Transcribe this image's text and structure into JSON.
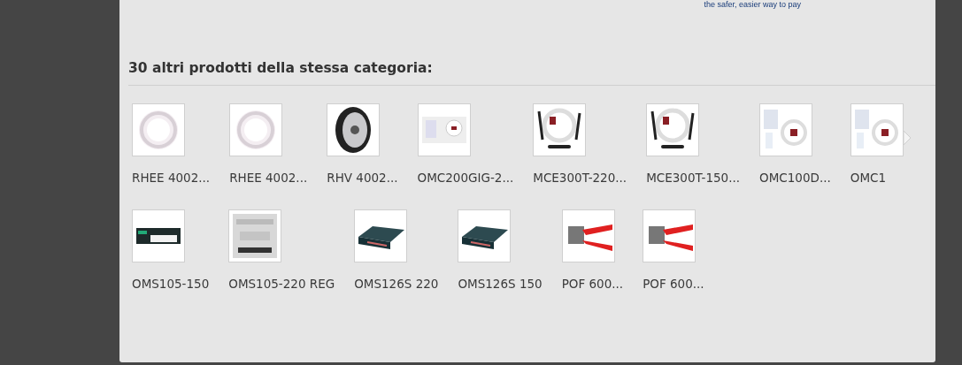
{
  "paypal_note": "the safer, easier way to pay",
  "section": {
    "title": "30 altri prodotti della stessa categoria:",
    "rows": [
      {
        "items": [
          {
            "label": "RHEE 4002..."
          },
          {
            "label": "RHEE 4002..."
          },
          {
            "label": "RHV 4002..."
          },
          {
            "label": "OMC200GIG-2..."
          },
          {
            "label": "MCE300T-220..."
          },
          {
            "label": "MCE300T-150..."
          },
          {
            "label": "OMC100D..."
          },
          {
            "label": "OMC1"
          }
        ],
        "has_next": true
      },
      {
        "items": [
          {
            "label": "OMS105-150"
          },
          {
            "label": "OMS105-220 REG"
          },
          {
            "label": "OMS126S 220"
          },
          {
            "label": "OMS126S 150"
          },
          {
            "label": "POF 600..."
          },
          {
            "label": "POF 600..."
          }
        ]
      }
    ]
  }
}
